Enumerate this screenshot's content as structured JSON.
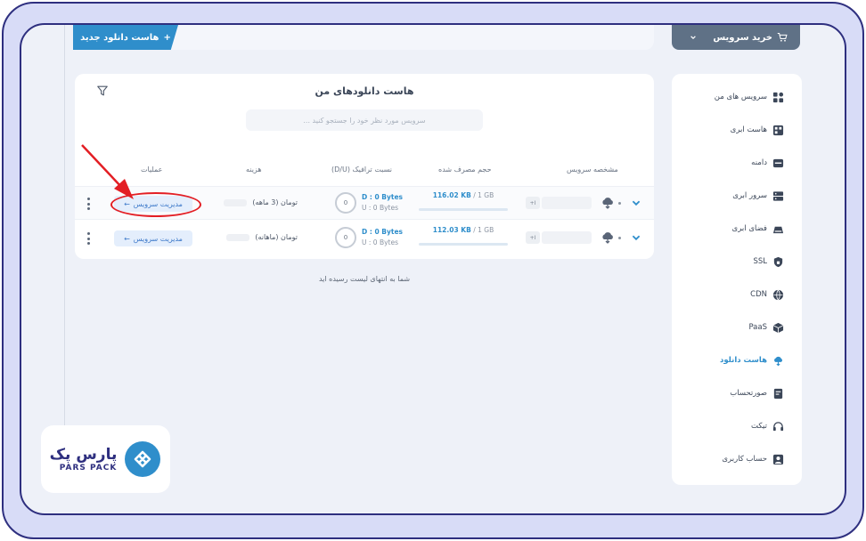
{
  "header": {
    "new_host_button": "هاست دانلود جدید",
    "new_host_icon": "plus-icon",
    "buy_service_button": "خرید سرویس",
    "buy_service_icon": "cart-icon"
  },
  "main": {
    "title": "هاست دانلودهای من",
    "search_placeholder": "سرویس مورد نظر خود را جستجو کنید ...",
    "columns": {
      "service_spec": "مشخصه سرویس",
      "usage": "حجم مصرف شده",
      "traffic_ratio": "نسبت ترافیک (D/U)",
      "cost": "هزینه",
      "operations": "عملیات"
    },
    "rows": [
      {
        "chip": "+I",
        "usage_used": "116.02 KB",
        "usage_total": " / 1 GB",
        "traffic_pct": "0",
        "download": "D : 0 Bytes",
        "upload": "U : 0 Bytes",
        "cost": "تومان (3 ماهه)",
        "manage": "مدیریت سرویس"
      },
      {
        "chip": "+I",
        "usage_used": "112.03 KB",
        "usage_total": " / 1 GB",
        "traffic_pct": "0",
        "download": "D : 0 Bytes",
        "upload": "U : 0 Bytes",
        "cost": "تومان (ماهانه)",
        "manage": "مدیریت سرویس"
      }
    ],
    "end_of_list": "شما به انتهای لیست رسیده اید"
  },
  "sidebar": {
    "items": [
      {
        "label": "سرویس های من",
        "icon": "grid-icon"
      },
      {
        "label": "هاست ابری",
        "icon": "cloud-host-icon"
      },
      {
        "label": "دامنه",
        "icon": "domain-icon"
      },
      {
        "label": "سرور ابری",
        "icon": "server-icon"
      },
      {
        "label": "فضای ابری",
        "icon": "storage-icon"
      },
      {
        "label": "SSL",
        "icon": "lock-icon"
      },
      {
        "label": "CDN",
        "icon": "cdn-icon"
      },
      {
        "label": "PaaS",
        "icon": "cube-icon"
      },
      {
        "label": "هاست دانلود",
        "icon": "download-cloud-icon"
      },
      {
        "label": "صورتحساب",
        "icon": "invoice-icon"
      },
      {
        "label": "تیکت",
        "icon": "headset-icon"
      },
      {
        "label": "حساب کاربری",
        "icon": "user-icon"
      }
    ]
  },
  "logo": {
    "name_fa": "پارس پک",
    "name_en": "PARS PACK"
  },
  "colors": {
    "accent": "#2f8ecb",
    "brand": "#2e2f7f",
    "annotation": "#e31e24"
  }
}
